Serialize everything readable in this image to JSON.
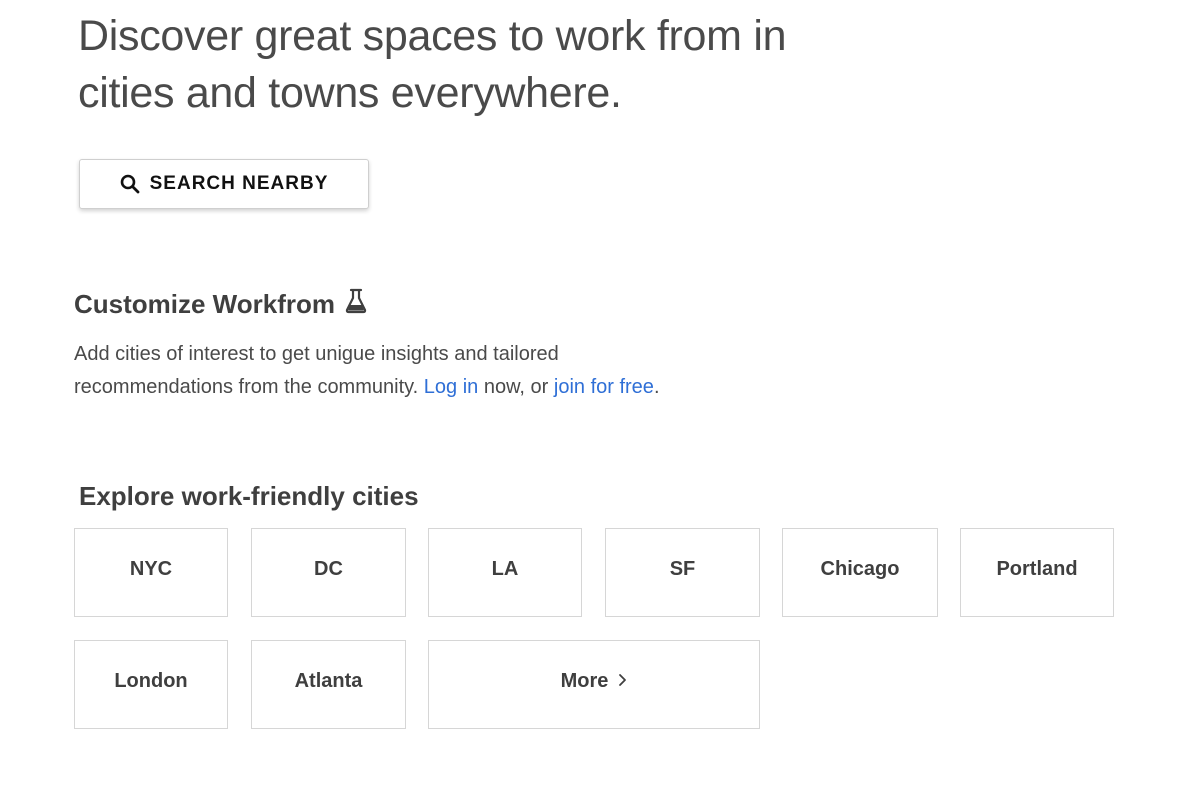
{
  "hero": {
    "title": "Discover great spaces to work from in cities and towns everywhere."
  },
  "search": {
    "label": "SEARCH NEARBY",
    "icon": "search-icon"
  },
  "customize": {
    "title": "Customize Workfrom",
    "icon": "flask-icon",
    "text_before": "Add cities of interest to get unigue insights and tailored recommendations from the community. ",
    "login_link": "Log in",
    "text_middle": " now, or ",
    "join_link": "join for free",
    "text_after": "."
  },
  "explore": {
    "title": "Explore work-friendly cities",
    "cities": [
      "NYC",
      "DC",
      "LA",
      "SF",
      "Chicago",
      "Portland",
      "London",
      "Atlanta"
    ],
    "more_label": "More",
    "more_icon": "chevron-right-icon"
  }
}
